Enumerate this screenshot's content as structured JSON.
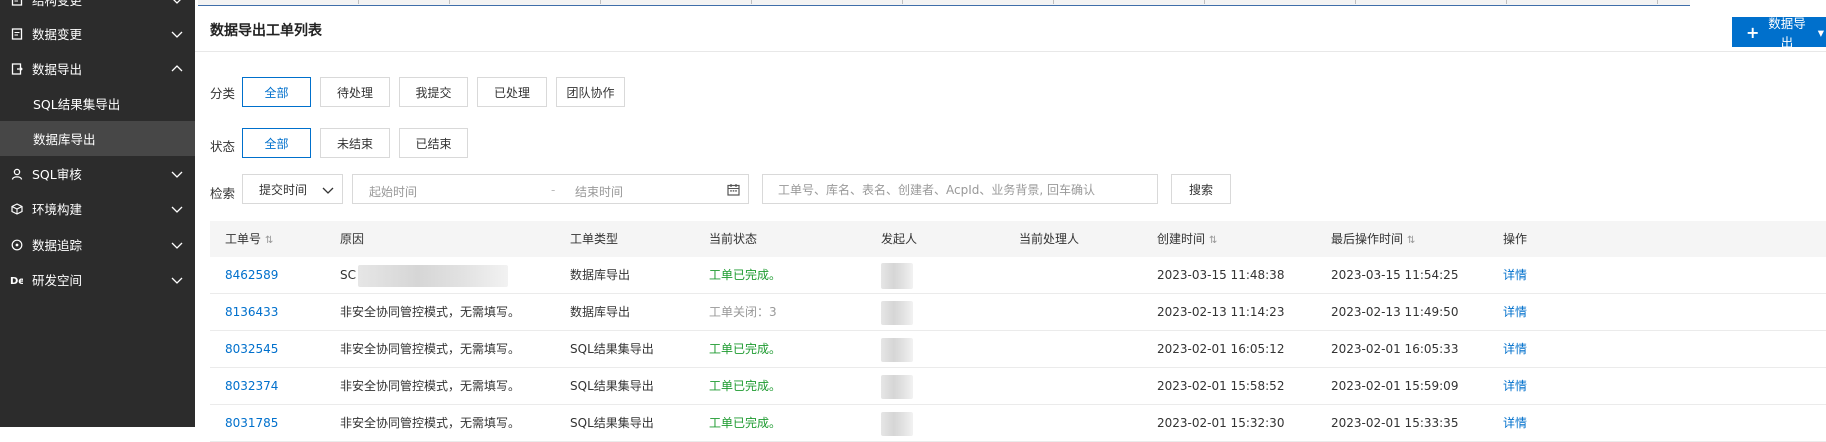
{
  "sidebar": {
    "items": [
      {
        "label": "结构变更",
        "icon": "doc-icon",
        "expanded": false
      },
      {
        "label": "数据变更",
        "icon": "doc-icon",
        "expanded": false
      },
      {
        "label": "数据导出",
        "icon": "export-icon",
        "expanded": true
      },
      {
        "label": "SQL审核",
        "icon": "user-icon",
        "expanded": false
      },
      {
        "label": "环境构建",
        "icon": "cube-icon",
        "expanded": false
      },
      {
        "label": "数据追踪",
        "icon": "target-icon",
        "expanded": false
      },
      {
        "label": "研发空间",
        "icon": "dev-icon",
        "expanded": false
      }
    ],
    "sub_items": [
      {
        "label": "SQL结果集导出",
        "active": false
      },
      {
        "label": "数据库导出",
        "active": true
      }
    ]
  },
  "header": {
    "title": "数据导出工单列表",
    "primary_button": "数据导出"
  },
  "filters": {
    "category": {
      "label": "分类",
      "options": [
        "全部",
        "待处理",
        "我提交",
        "已处理",
        "团队协作"
      ],
      "selected": "全部"
    },
    "status": {
      "label": "状态",
      "options": [
        "全部",
        "未结束",
        "已结束"
      ],
      "selected": "全部"
    },
    "search": {
      "label": "检索",
      "time_field": "提交时间",
      "start_placeholder": "起始时间",
      "end_placeholder": "结束时间",
      "separator": "-",
      "keyword_placeholder": "工单号、库名、表名、创建者、AcpId、业务背景, 回车确认",
      "button": "搜索"
    }
  },
  "table": {
    "columns": [
      "工单号",
      "原因",
      "工单类型",
      "当前状态",
      "发起人",
      "当前处理人",
      "创建时间",
      "最后操作时间",
      "操作"
    ],
    "rows": [
      {
        "id": "8462589",
        "reason": "SC",
        "type": "数据库导出",
        "status": "工单已完成。",
        "status_kind": "ok",
        "created": "2023-03-15 11:48:38",
        "updated": "2023-03-15 11:54:25",
        "action": "详情"
      },
      {
        "id": "8136433",
        "reason": "非安全协同管控模式，无需填写。",
        "type": "数据库导出",
        "status": "工单关闭：3",
        "status_kind": "closed",
        "created": "2023-02-13 11:14:23",
        "updated": "2023-02-13 11:49:50",
        "action": "详情"
      },
      {
        "id": "8032545",
        "reason": "非安全协同管控模式，无需填写。",
        "type": "SQL结果集导出",
        "status": "工单已完成。",
        "status_kind": "ok",
        "created": "2023-02-01 16:05:12",
        "updated": "2023-02-01 16:05:33",
        "action": "详情"
      },
      {
        "id": "8032374",
        "reason": "非安全协同管控模式，无需填写。",
        "type": "SQL结果集导出",
        "status": "工单已完成。",
        "status_kind": "ok",
        "created": "2023-02-01 15:58:52",
        "updated": "2023-02-01 15:59:09",
        "action": "详情"
      },
      {
        "id": "8031785",
        "reason": "非安全协同管控模式，无需填写。",
        "type": "SQL结果集导出",
        "status": "工单已完成。",
        "status_kind": "ok",
        "created": "2023-02-01 15:32:30",
        "updated": "2023-02-01 15:33:35",
        "action": "详情"
      }
    ]
  },
  "colors": {
    "primary": "#0070cc",
    "success": "#1e9b30",
    "sidebar_bg": "#2c2c2c",
    "sidebar_active": "#474747"
  }
}
